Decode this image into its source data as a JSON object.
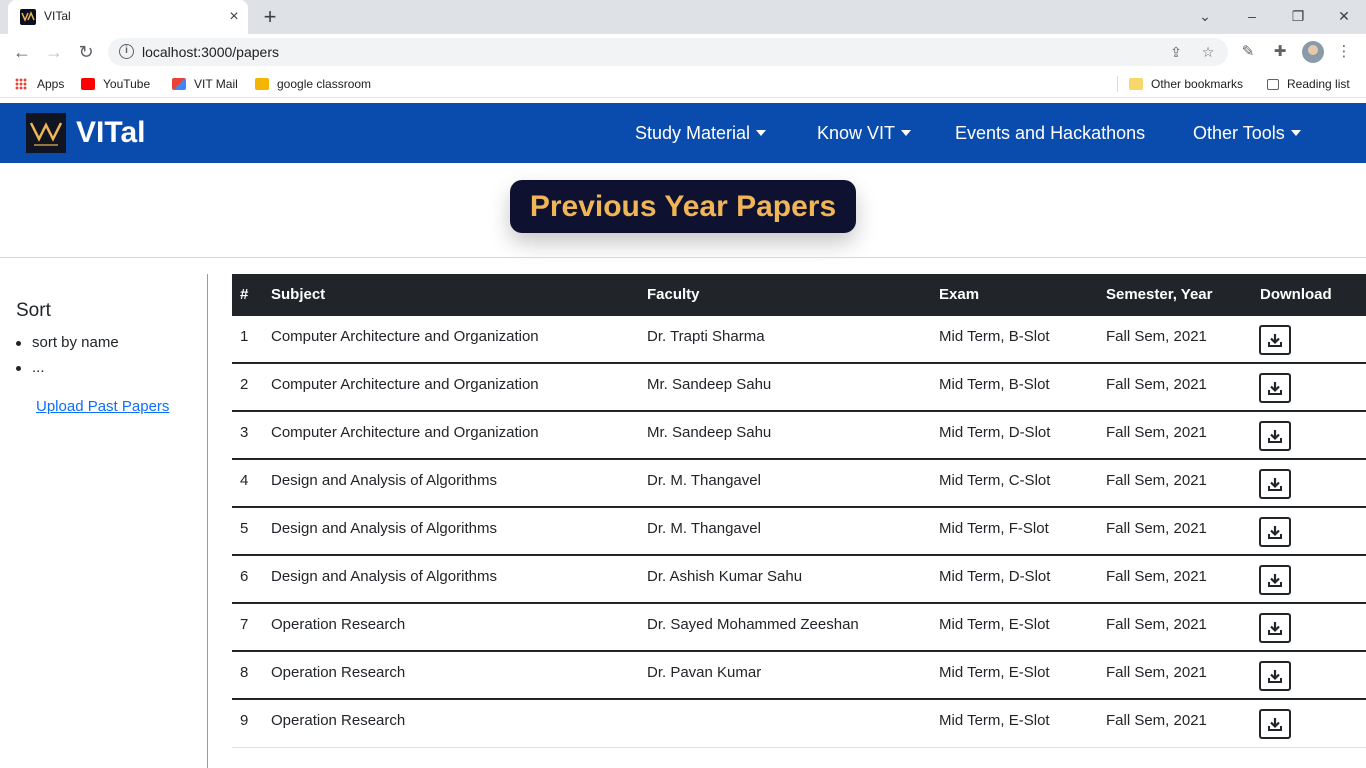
{
  "browser": {
    "tab_title": "VITal",
    "url": "localhost:3000/papers",
    "bookmarks": [
      "Apps",
      "YouTube",
      "VIT Mail",
      "google classroom"
    ],
    "other_bookmarks": "Other bookmarks",
    "reading_list": "Reading list"
  },
  "site": {
    "brand": "VITal",
    "nav": [
      "Study Material",
      "Know VIT",
      "Events and Hackathons",
      "Other Tools"
    ],
    "heading": "Previous Year Papers"
  },
  "sidebar": {
    "title": "Sort",
    "items": [
      "sort by name",
      "..."
    ],
    "upload_link": "Upload Past Papers"
  },
  "table": {
    "headers": [
      "#",
      "Subject",
      "Faculty",
      "Exam",
      "Semester, Year",
      "Download"
    ],
    "rows": [
      {
        "num": "1",
        "subject": "Computer Architecture and Organization",
        "faculty": "Dr. Trapti Sharma",
        "exam": "Mid Term, B-Slot",
        "semester": "Fall Sem, 2021"
      },
      {
        "num": "2",
        "subject": "Computer Architecture and Organization",
        "faculty": "Mr. Sandeep Sahu",
        "exam": "Mid Term, B-Slot",
        "semester": "Fall Sem, 2021"
      },
      {
        "num": "3",
        "subject": "Computer Architecture and Organization",
        "faculty": "Mr. Sandeep Sahu",
        "exam": "Mid Term, D-Slot",
        "semester": "Fall Sem, 2021"
      },
      {
        "num": "4",
        "subject": "Design and Analysis of Algorithms",
        "faculty": "Dr. M. Thangavel",
        "exam": "Mid Term, C-Slot",
        "semester": "Fall Sem, 2021"
      },
      {
        "num": "5",
        "subject": "Design and Analysis of Algorithms",
        "faculty": "Dr. M. Thangavel",
        "exam": "Mid Term, F-Slot",
        "semester": "Fall Sem, 2021"
      },
      {
        "num": "6",
        "subject": "Design and Analysis of Algorithms",
        "faculty": "Dr. Ashish Kumar Sahu",
        "exam": "Mid Term, D-Slot",
        "semester": "Fall Sem, 2021"
      },
      {
        "num": "7",
        "subject": "Operation Research",
        "faculty": "Dr. Sayed Mohammed Zeeshan",
        "exam": "Mid Term, E-Slot",
        "semester": "Fall Sem, 2021"
      },
      {
        "num": "8",
        "subject": "Operation Research",
        "faculty": "Dr. Pavan Kumar",
        "exam": "Mid Term, E-Slot",
        "semester": "Fall Sem, 2021"
      },
      {
        "num": "9",
        "subject": "Operation Research",
        "faculty": "",
        "exam": "Mid Term, E-Slot",
        "semester": "Fall Sem, 2021"
      }
    ]
  },
  "colors": {
    "navbar": "#0a4cad",
    "heading_bg": "#0e1230",
    "heading_text": "#f0b557",
    "table_header": "#212529",
    "link": "#0d6efd"
  }
}
